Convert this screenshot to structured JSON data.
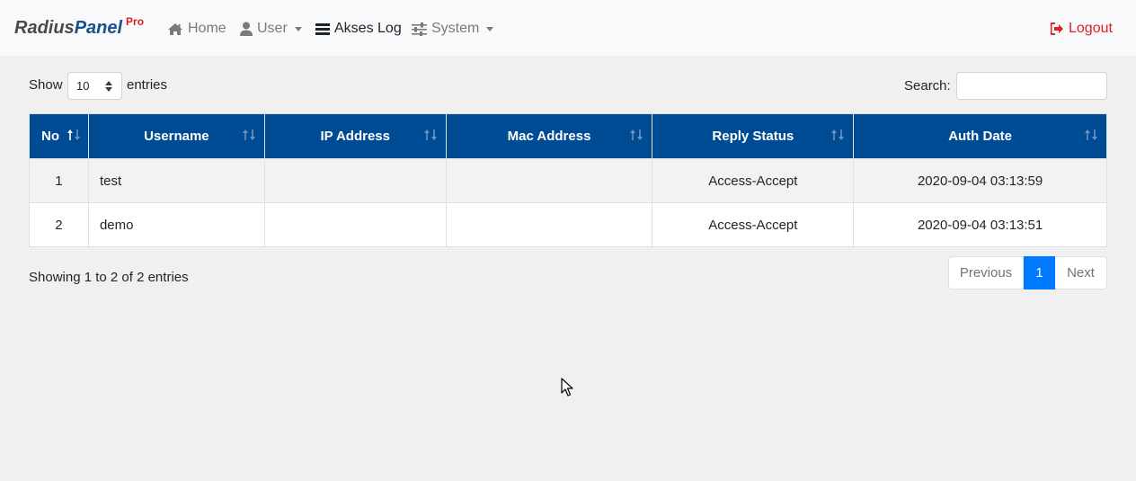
{
  "brand": {
    "part1": "Radius",
    "part2": "Panel",
    "badge": "Pro"
  },
  "nav": {
    "home": "Home",
    "user": "User",
    "akses_log": "Akses Log",
    "system": "System",
    "logout": "Logout"
  },
  "controls": {
    "show_label": "Show",
    "page_length": "10",
    "entries_label": "entries",
    "search_label": "Search:",
    "search_value": ""
  },
  "table": {
    "columns": [
      "No",
      "Username",
      "IP Address",
      "Mac Address",
      "Reply Status",
      "Auth Date"
    ],
    "rows": [
      {
        "no": "1",
        "username": "test",
        "ip_address": "",
        "mac_address": "",
        "reply_status": "Access-Accept",
        "auth_date": "2020-09-04 03:13:59"
      },
      {
        "no": "2",
        "username": "demo",
        "ip_address": "",
        "mac_address": "",
        "reply_status": "Access-Accept",
        "auth_date": "2020-09-04 03:13:51"
      }
    ]
  },
  "footer": {
    "info": "Showing 1 to 2 of 2 entries",
    "previous": "Previous",
    "current_page": "1",
    "next": "Next"
  },
  "colors": {
    "header_bg": "#004c94",
    "accent": "#007bff",
    "logout": "#dc1f26",
    "brand_dark": "#4a4a4a",
    "brand_blue": "#1b4f8a"
  },
  "icons": {
    "home": "home-icon",
    "user": "user-icon",
    "akses_log": "bars-icon",
    "system": "sliders-icon",
    "logout": "sign-out-icon"
  }
}
